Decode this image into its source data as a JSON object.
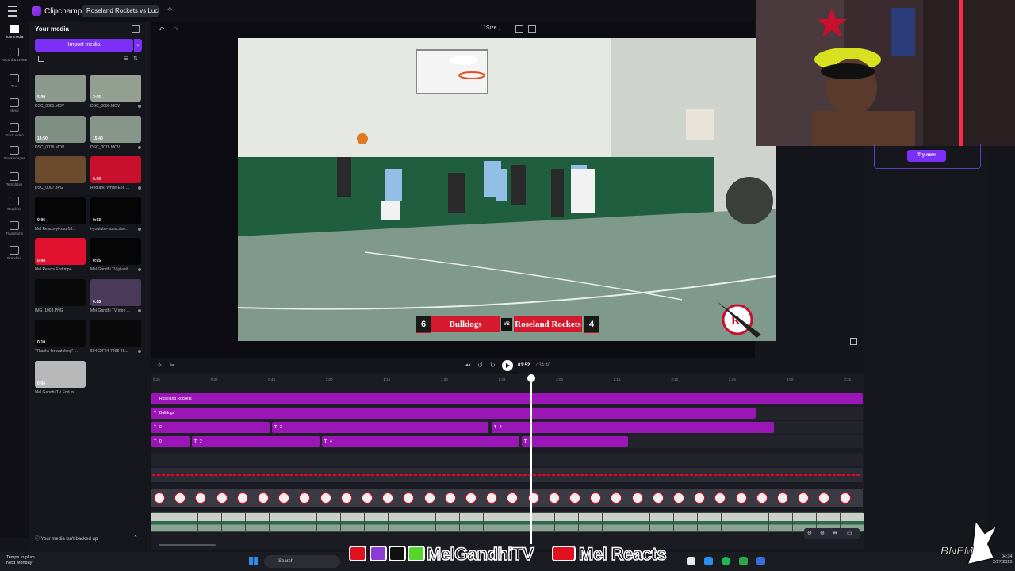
{
  "app": {
    "name": "Clipchamp",
    "project_title": "Roseland Rockets vs Lucky L"
  },
  "rail": [
    {
      "label": "Your media",
      "icon": "folder-icon",
      "active": true
    },
    {
      "label": "Record & create",
      "icon": "camera-icon"
    },
    {
      "label": "Text",
      "icon": "text-icon"
    },
    {
      "label": "Music",
      "icon": "music-icon"
    },
    {
      "label": "Stock video",
      "icon": "stock-video-icon"
    },
    {
      "label": "Stock images",
      "icon": "stock-images-icon"
    },
    {
      "label": "Templates",
      "icon": "templates-icon"
    },
    {
      "label": "Graphics",
      "icon": "graphics-icon"
    },
    {
      "label": "Transitions",
      "icon": "transitions-icon"
    },
    {
      "label": "Brand kit",
      "icon": "brand-kit-icon"
    }
  ],
  "media": {
    "title": "Your media",
    "import_label": "Import media",
    "backup_notice": "Your media isn't backed up",
    "items": [
      {
        "name": "DSC_0081.MOV",
        "duration": "5:09",
        "color": "#8c9a8e"
      },
      {
        "name": "DSC_0080.MOV",
        "duration": "3:05",
        "color": "#94a092"
      },
      {
        "name": "DSC_0079.MOV",
        "duration": "14:50",
        "color": "#7f8f84"
      },
      {
        "name": "DSC_0078.MOV",
        "duration": "15:40",
        "color": "#88968a"
      },
      {
        "name": "DSC_0007.JPG",
        "duration": "",
        "color": "#6b4a2e"
      },
      {
        "name": "Red and White End ...",
        "duration": "0:05",
        "color": "#c8102e"
      },
      {
        "name": "Mel Reacts-yt-sku-18...",
        "duration": "0:06",
        "color": "#050505"
      },
      {
        "name": "t-youtube-subscribe...",
        "duration": "0:03",
        "color": "#050505"
      },
      {
        "name": "Mel Reacts End.mp4",
        "duration": "0:04",
        "color": "#e0102e"
      },
      {
        "name": "Mel Gandhi TV-yt-sub...",
        "duration": "0:05",
        "color": "#050505"
      },
      {
        "name": "IMG_1003.PNG",
        "duration": "",
        "color": "#0a0a0a"
      },
      {
        "name": "Mel Gandhi TV intro ...",
        "duration": "0:08",
        "color": "#4a3a5a"
      },
      {
        "name": "\"Thanks for watching\" ...",
        "duration": "0:10",
        "color": "#0a0a0a"
      },
      {
        "name": "594C2F24-7998-48...",
        "duration": "",
        "color": "#0a0a0a"
      },
      {
        "name": "Mel Gandhi TV End.m...",
        "duration": "0:04",
        "color": "#b8b8b8"
      }
    ]
  },
  "preview": {
    "size_label": "Size",
    "current_time": "01:52",
    "total_time": "/ 34:40"
  },
  "scoreboard": {
    "home_team": "Bulldogs",
    "home_score": "6",
    "vs": "VS",
    "away_team": "Roseland Rockets",
    "away_score": "4"
  },
  "promo": {
    "button": "Try now"
  },
  "timeline": {
    "ruler": [
      "0:15",
      "0:30",
      "0:45",
      "1:00",
      "1:15",
      "1:30",
      "1:45",
      "2:00",
      "2:15",
      "2:30",
      "2:45",
      "3:00",
      "3:15"
    ],
    "tracks": [
      [
        {
          "label": "Roseland Rockets"
        }
      ],
      [
        {
          "label": "Bulldogs"
        }
      ],
      [
        {
          "label": "0"
        },
        {
          "label": "2"
        },
        {
          "label": "4"
        }
      ],
      [
        {
          "label": "0"
        },
        {
          "label": "2"
        },
        {
          "label": "4"
        },
        {
          "label": "6"
        }
      ]
    ]
  },
  "taskbar": {
    "weather_line1": "Temps to plum...",
    "weather_line2": "Next Monday",
    "search_placeholder": "Search",
    "time": "04:34",
    "date": "2/27/2025"
  },
  "branding": {
    "channel1": "MelGandhiTV",
    "channel2": "Mel Reacts",
    "logo": "BNEM"
  },
  "colors": {
    "accent": "#7b2ff7",
    "track": "#9b16b6",
    "scoreboard_red": "#d61a2e"
  }
}
